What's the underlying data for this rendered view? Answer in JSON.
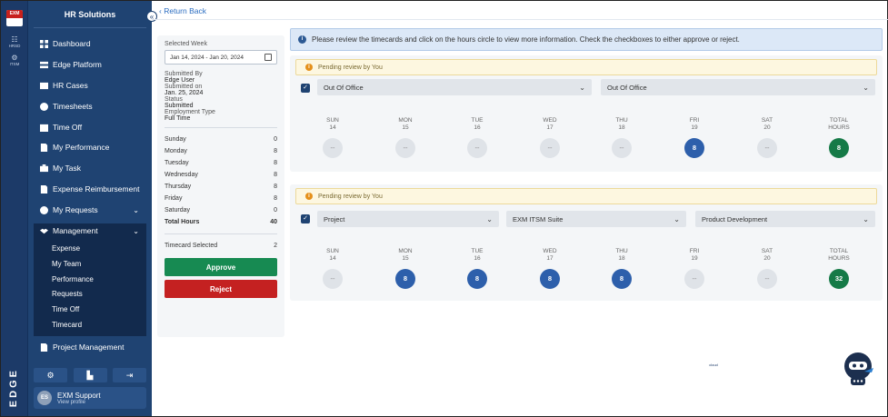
{
  "rail": {
    "logo_top": "EXM",
    "logo_bottom": "cloud",
    "items": [
      {
        "label": "HRSD"
      },
      {
        "label": "ITSM"
      }
    ],
    "brand": "EDGE"
  },
  "sidebar": {
    "title": "HR Solutions",
    "collapse_icon": "«",
    "items": [
      {
        "label": "Dashboard"
      },
      {
        "label": "Edge Platform"
      },
      {
        "label": "HR Cases"
      },
      {
        "label": "Timesheets"
      },
      {
        "label": "Time Off"
      },
      {
        "label": "My Performance"
      },
      {
        "label": "My Task"
      },
      {
        "label": "Expense Reimbursement"
      },
      {
        "label": "My Requests"
      }
    ],
    "management": {
      "label": "Management",
      "subitems": [
        {
          "label": "Expense"
        },
        {
          "label": "My Team"
        },
        {
          "label": "Performance"
        },
        {
          "label": "Requests"
        },
        {
          "label": "Time Off"
        },
        {
          "label": "Timecard"
        }
      ]
    },
    "project_management": "Project Management",
    "profile": {
      "initials": "ES",
      "name": "EXM Support",
      "link": "View profile"
    }
  },
  "main": {
    "back_label": "Return Back",
    "left": {
      "selected_week_label": "Selected Week",
      "selected_week_value": "Jan 14, 2024 - Jan 20, 2024",
      "submitted_by_label": "Submitted By",
      "submitted_by_value": "Edge User",
      "submitted_on_label": "Submitted on",
      "submitted_on_value": "Jan. 25, 2024",
      "status_label": "Status",
      "status_value": "Submitted",
      "employment_label": "Employment Type",
      "employment_value": "Full Time",
      "days": [
        {
          "day": "Sunday",
          "hours": "0"
        },
        {
          "day": "Monday",
          "hours": "8"
        },
        {
          "day": "Tuesday",
          "hours": "8"
        },
        {
          "day": "Wednesday",
          "hours": "8"
        },
        {
          "day": "Thursday",
          "hours": "8"
        },
        {
          "day": "Friday",
          "hours": "8"
        },
        {
          "day": "Saturday",
          "hours": "0"
        }
      ],
      "total_label": "Total Hours",
      "total_value": "40",
      "selected_label": "Timecard Selected",
      "selected_value": "2",
      "approve": "Approve",
      "reject": "Reject"
    },
    "info_text": "Please review the timecards and click on the hours circle to view more information. Check the checkboxes to either approve or reject.",
    "pending_text": "Pending review by You",
    "headers": [
      {
        "d": "SUN",
        "n": "14"
      },
      {
        "d": "MON",
        "n": "15"
      },
      {
        "d": "TUE",
        "n": "16"
      },
      {
        "d": "WED",
        "n": "17"
      },
      {
        "d": "THU",
        "n": "18"
      },
      {
        "d": "FRI",
        "n": "19"
      },
      {
        "d": "SAT",
        "n": "20"
      },
      {
        "d": "TOTAL",
        "n": "HOURS"
      }
    ],
    "card1": {
      "selects": [
        "Out Of Office",
        "Out Of Office"
      ],
      "values": [
        "--",
        "--",
        "--",
        "--",
        "--",
        "8",
        "--",
        "8"
      ]
    },
    "card2": {
      "selects": [
        "Project",
        "EXM ITSM Suite",
        "Product Development"
      ],
      "values": [
        "--",
        "8",
        "8",
        "8",
        "8",
        "--",
        "--",
        "32"
      ]
    }
  },
  "colors": {
    "sidebar": "#1f4372",
    "approve": "#178a52",
    "reject": "#c42121",
    "hours_blue": "#2d5fab",
    "total_green": "#157a47"
  }
}
